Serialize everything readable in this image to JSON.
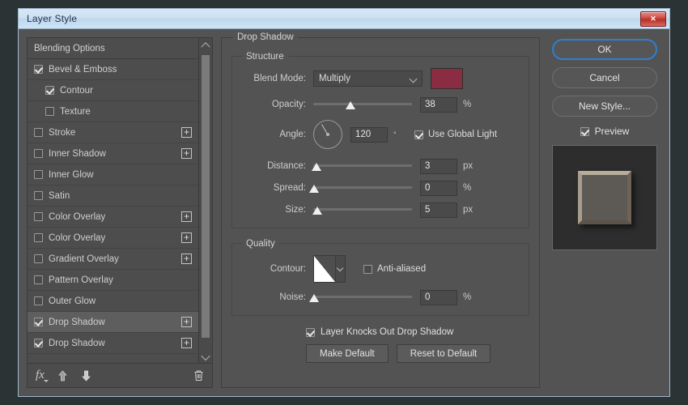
{
  "window": {
    "title": "Layer Style",
    "close_label": "✕"
  },
  "sidebar": {
    "items": [
      {
        "label": "Blending Options",
        "checked": null,
        "indent": 0,
        "plus": false,
        "selected": false
      },
      {
        "label": "Bevel & Emboss",
        "checked": true,
        "indent": 0,
        "plus": false,
        "selected": false
      },
      {
        "label": "Contour",
        "checked": true,
        "indent": 1,
        "plus": false,
        "selected": false
      },
      {
        "label": "Texture",
        "checked": false,
        "indent": 1,
        "plus": false,
        "selected": false
      },
      {
        "label": "Stroke",
        "checked": false,
        "indent": 0,
        "plus": true,
        "selected": false
      },
      {
        "label": "Inner Shadow",
        "checked": false,
        "indent": 0,
        "plus": true,
        "selected": false
      },
      {
        "label": "Inner Glow",
        "checked": false,
        "indent": 0,
        "plus": false,
        "selected": false
      },
      {
        "label": "Satin",
        "checked": false,
        "indent": 0,
        "plus": false,
        "selected": false
      },
      {
        "label": "Color Overlay",
        "checked": false,
        "indent": 0,
        "plus": true,
        "selected": false
      },
      {
        "label": "Color Overlay",
        "checked": false,
        "indent": 0,
        "plus": true,
        "selected": false
      },
      {
        "label": "Gradient Overlay",
        "checked": false,
        "indent": 0,
        "plus": true,
        "selected": false
      },
      {
        "label": "Pattern Overlay",
        "checked": false,
        "indent": 0,
        "plus": false,
        "selected": false
      },
      {
        "label": "Outer Glow",
        "checked": false,
        "indent": 0,
        "plus": false,
        "selected": false
      },
      {
        "label": "Drop Shadow",
        "checked": true,
        "indent": 0,
        "plus": true,
        "selected": true
      },
      {
        "label": "Drop Shadow",
        "checked": true,
        "indent": 0,
        "plus": true,
        "selected": false
      }
    ],
    "tools": [
      {
        "name": "fx-icon",
        "glyph": "fx"
      },
      {
        "name": "move-up-icon",
        "glyph": "▲"
      },
      {
        "name": "move-down-icon",
        "glyph": "▼"
      },
      {
        "name": "delete-icon",
        "glyph": "🗑"
      }
    ]
  },
  "panel": {
    "title": "Drop Shadow",
    "structure": {
      "title": "Structure",
      "blend_mode": {
        "label": "Blend Mode:",
        "value": "Multiply"
      },
      "color": {
        "hex": "#8a2d42"
      },
      "opacity": {
        "label": "Opacity:",
        "value": "38",
        "unit": "%",
        "percent": 38
      },
      "angle": {
        "label": "Angle:",
        "value": "120",
        "unit": "°",
        "degrees": 120
      },
      "global_light": {
        "label": "Use Global Light",
        "checked": true
      },
      "distance": {
        "label": "Distance:",
        "value": "3",
        "unit": "px",
        "percent": 3
      },
      "spread": {
        "label": "Spread:",
        "value": "0",
        "unit": "%",
        "percent": 1
      },
      "size": {
        "label": "Size:",
        "value": "5",
        "unit": "px",
        "percent": 4
      }
    },
    "quality": {
      "title": "Quality",
      "contour": {
        "label": "Contour:"
      },
      "anti_aliased": {
        "label": "Anti-aliased",
        "checked": false
      },
      "noise": {
        "label": "Noise:",
        "value": "0",
        "unit": "%",
        "percent": 1
      }
    },
    "knockout": {
      "label": "Layer Knocks Out Drop Shadow",
      "checked": true
    },
    "make_default": "Make Default",
    "reset_default": "Reset to Default"
  },
  "actions": {
    "ok": "OK",
    "cancel": "Cancel",
    "new_style": "New Style...",
    "preview": {
      "label": "Preview",
      "checked": true
    }
  }
}
